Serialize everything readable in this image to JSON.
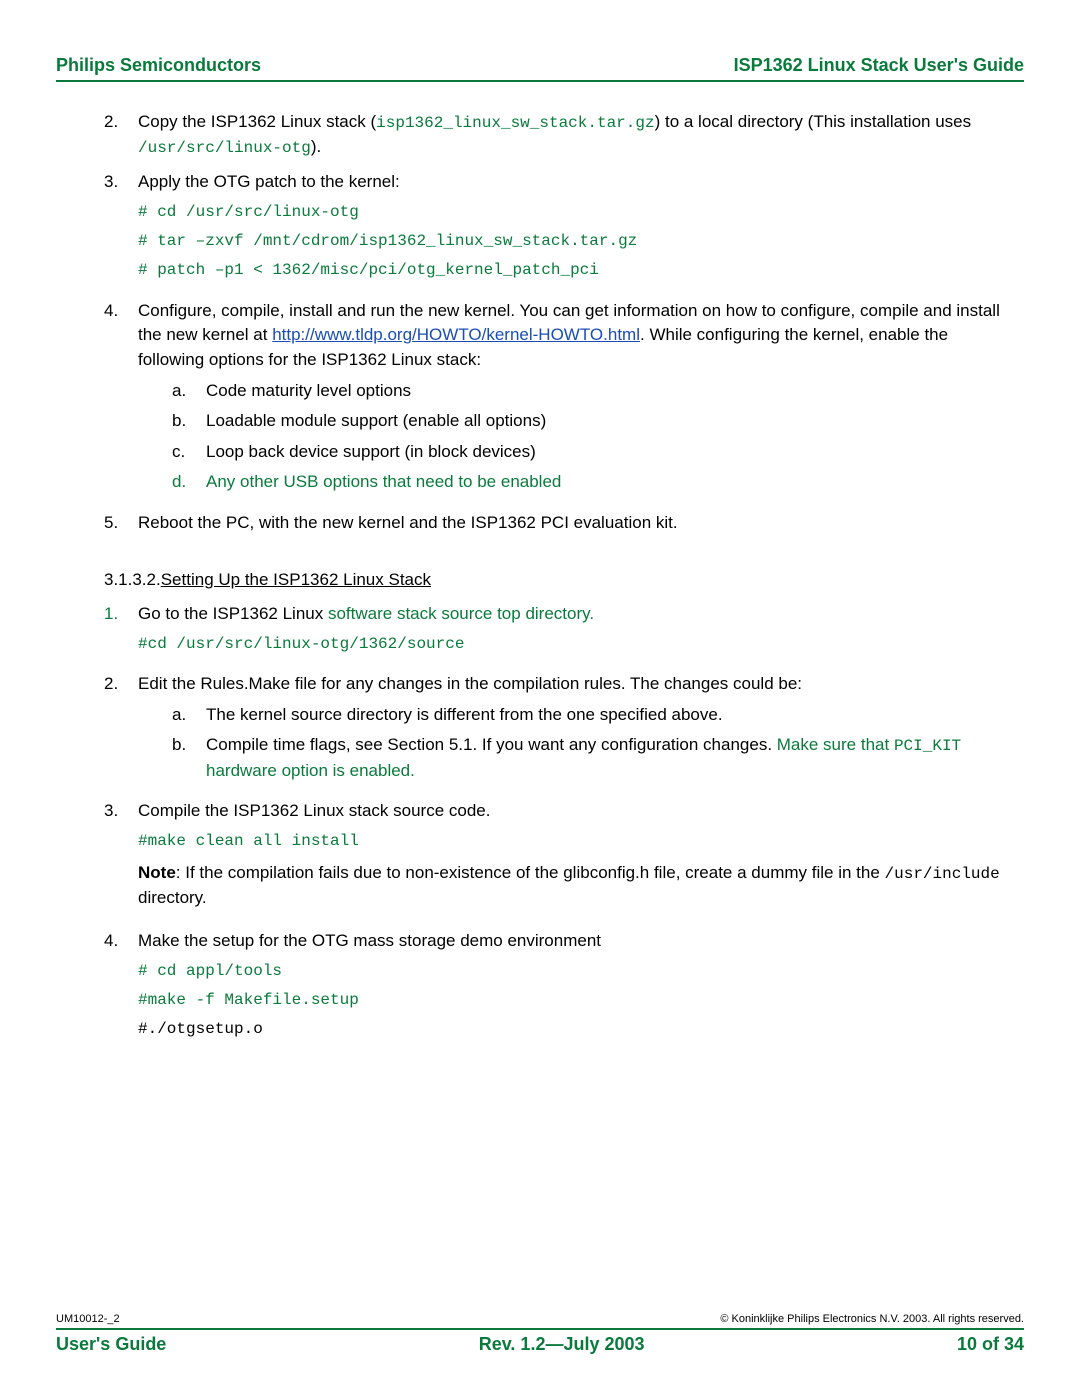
{
  "header": {
    "left": "Philips Semiconductors",
    "right": "ISP1362 Linux Stack User's Guide"
  },
  "step2": {
    "num": "2.",
    "t1": "Copy the ISP1362 Linux stack (",
    "code1": "isp1362_linux_sw_stack.tar.gz",
    "t2": ") to a local directory (This installation uses ",
    "code2": "/usr/src/linux-otg",
    "t3": ")."
  },
  "step3": {
    "num": "3.",
    "text": "Apply the OTG patch to the kernel:",
    "c1": "# cd /usr/src/linux-otg",
    "c2": "# tar –zxvf /mnt/cdrom/isp1362_linux_sw_stack.tar.gz",
    "c3": "# patch –p1 < 1362/misc/pci/otg_kernel_patch_pci"
  },
  "step4": {
    "num": "4.",
    "t1": "Configure, compile, install and run the new kernel. You can get information on how to configure, compile and install the new kernel at ",
    "link": "http://www.tldp.org/HOWTO/kernel-HOWTO.html",
    "t2": ". While configuring the kernel, enable the following options for the ISP1362 Linux stack:",
    "a": {
      "l": "a.",
      "t": "Code maturity level options"
    },
    "b": {
      "l": "b.",
      "t": "Loadable module support (enable all options)"
    },
    "c": {
      "l": "c.",
      "t": "Loop back device support (in block devices)"
    },
    "d": {
      "l": "d.",
      "t": "Any other USB options that need to  be enabled"
    }
  },
  "step5": {
    "num": "5.",
    "text": "Reboot the PC, with the new kernel and the ISP1362 PCI evaluation kit."
  },
  "section": {
    "num": "3.1.3.2.",
    "title": "Setting Up the ISP1362 Linux Stack"
  },
  "b1": {
    "num": "1.",
    "t1": "Go to the ISP1362 Linux ",
    "green": "software stack source top directory.",
    "c1": "#cd /usr/src/linux-otg/1362/source"
  },
  "b2": {
    "num": "2.",
    "text": "Edit the Rules.Make file for any changes in the compilation rules. The changes could be:",
    "a": {
      "l": "a.",
      "t": "The kernel source directory is different from the one specified above."
    },
    "b": {
      "l": "b.",
      "t1": "Compile time flags, see Section 5.1. If you want any configuration changes. ",
      "g1": "Make sure that ",
      "code": "PCI_KIT",
      "g2": " hardware option is enabled."
    }
  },
  "b3": {
    "num": "3.",
    "text": "Compile the ISP1362 Linux stack source code.",
    "c1": "#make clean all install",
    "note_bold": "Note",
    "note_t1": ": If the compilation fails due to non-existence of the glibconfig.h file, create a dummy file in the ",
    "note_code": "/usr/include",
    "note_t2": " directory."
  },
  "b4": {
    "num": "4.",
    "text": "Make the setup for the OTG mass storage demo environment",
    "c1": "# cd appl/tools",
    "c2": "#make -f Makefile.setup",
    "c3": "#./otgsetup.o"
  },
  "footer": {
    "doc_id": "UM10012-_2",
    "copyright": "© Koninklijke Philips Electronics N.V. 2003. All rights reserved.",
    "left": "User's Guide",
    "center": "Rev. 1.2—July 2003",
    "right": "10 of 34"
  }
}
